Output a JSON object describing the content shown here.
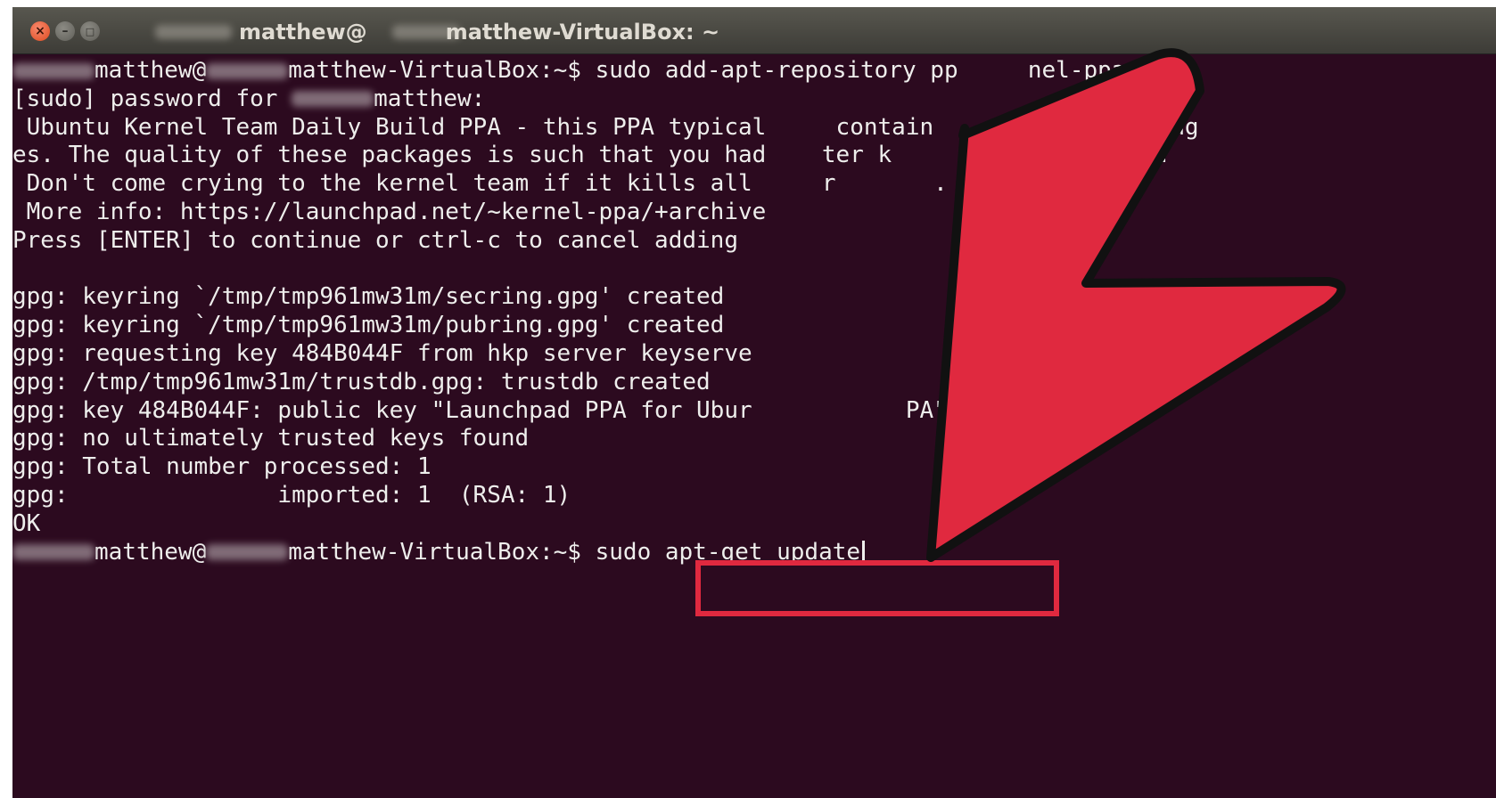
{
  "window": {
    "title_user": "matthew@",
    "title_host": "matthew-VirtualBox: ~",
    "buttons": [
      "close",
      "minimize",
      "maximize"
    ]
  },
  "terminal": {
    "lines": [
      {
        "prefix_blur": true,
        "user": "matthew@",
        "mid_blur": true,
        "rest": "matthew-VirtualBox:~$ sudo add-apt-repository pp     nel-ppa/ppa"
      },
      {
        "text": "[sudo] password for ",
        "tail_blur": true,
        "tail": "matthew:"
      },
      {
        "text": " Ubuntu Kernel Team Daily Build PPA - this PPA typical     contain     imental packag"
      },
      {
        "text": "es. The quality of these packages is such that you had    ter k     t you're doing."
      },
      {
        "text": " Don't come crying to the kernel team if it kills all     r       ."
      },
      {
        "text": " More info: https://launchpad.net/~kernel-ppa/+archive"
      },
      {
        "text": "Press [ENTER] to continue or ctrl-c to cancel adding"
      },
      {
        "text": ""
      },
      {
        "text": "gpg: keyring `/tmp/tmp961mw31m/secring.gpg' created"
      },
      {
        "text": "gpg: keyring `/tmp/tmp961mw31m/pubring.gpg' created"
      },
      {
        "text": "gpg: requesting key 484B044F from hkp server keyserve"
      },
      {
        "text": "gpg: /tmp/tmp961mw31m/trustdb.gpg: trustdb created"
      },
      {
        "text": "gpg: key 484B044F: public key \"Launchpad PPA for Ubur           PA\" imported"
      },
      {
        "text": "gpg: no ultimately trusted keys found"
      },
      {
        "text": "gpg: Total number processed: 1"
      },
      {
        "text": "gpg:               imported: 1  (RSA: 1)"
      },
      {
        "text": "OK"
      }
    ],
    "prompt": {
      "user": "matthew@",
      "host": "matthew-VirtualBox:~$ ",
      "command": "sudo apt-get update"
    }
  },
  "annotation": {
    "arrow_color": "#e0293f",
    "box_color": "#e0293f"
  }
}
